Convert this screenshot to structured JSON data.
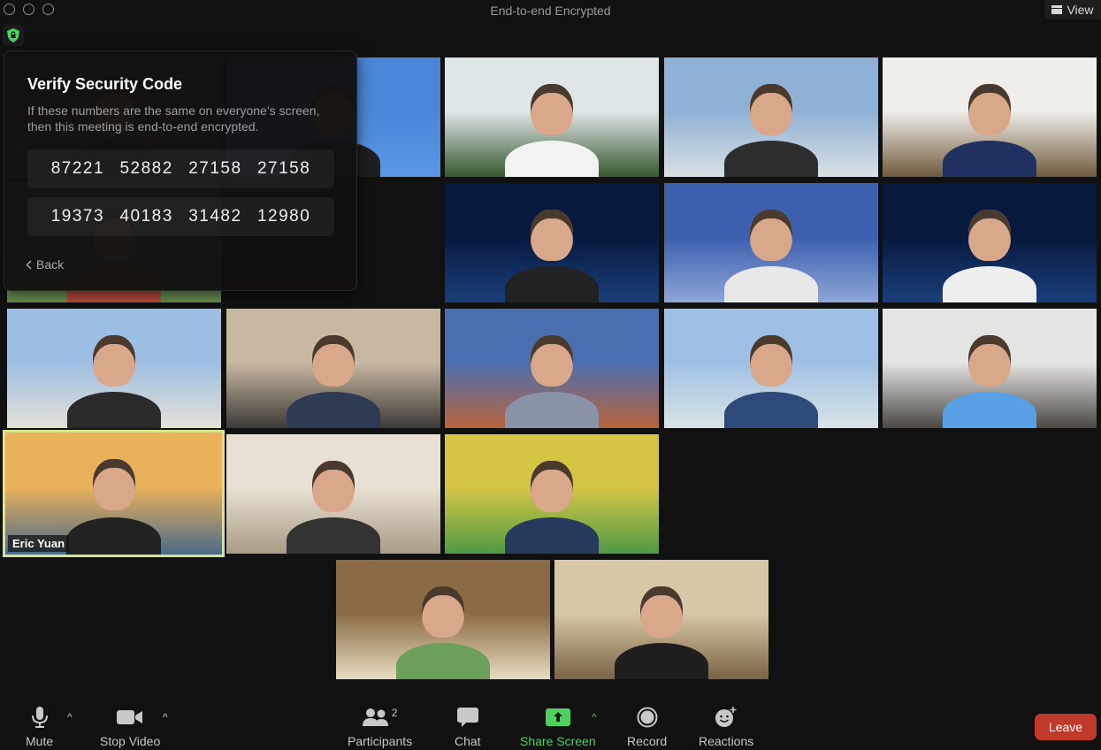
{
  "window": {
    "title": "End-to-end Encrypted",
    "view_label": "View"
  },
  "security_popup": {
    "title": "Verify Security Code",
    "description": "If these numbers are the same on everyone’s screen, then this meeting is end-to-end encrypted.",
    "code_rows": [
      [
        "87221",
        "52882",
        "27158",
        "27158"
      ],
      [
        "19373",
        "40183",
        "31482",
        "12980"
      ]
    ],
    "back_label": "Back"
  },
  "participants": {
    "active_speaker_name": "Eric Yuan",
    "tiles": [
      {
        "bg": "zoom-logo-wall-dark",
        "colors": [
          "#3d4150",
          "#5a5f72"
        ]
      },
      {
        "bg": "zoom-logo-wall-blue",
        "colors": [
          "#4a86d8",
          "#5b97e6"
        ]
      },
      {
        "bg": "city-plants",
        "colors": [
          "#dfe6e8",
          "#36582c"
        ]
      },
      {
        "bg": "beach",
        "colors": [
          "#8fb1d6",
          "#d9e0e3"
        ]
      },
      {
        "bg": "office-tv",
        "colors": [
          "#f0eeea",
          "#6f5b3c"
        ]
      },
      {
        "bg": "lagoon",
        "colors": [
          "#3f9c8c",
          "#6b8b4a"
        ]
      },
      {
        "bg": "beach",
        "colors": [
          "#a9c4e4",
          "#e2e4e2"
        ]
      },
      {
        "bg": "space-earth",
        "colors": [
          "#071a3e",
          "#1b3f7c"
        ]
      },
      {
        "bg": "blue-room",
        "colors": [
          "#3c5fae",
          "#8ea6d8"
        ]
      },
      {
        "bg": "space-earth",
        "colors": [
          "#071a3e",
          "#1b3f7c"
        ]
      },
      {
        "bg": "beach",
        "colors": [
          "#9dbfe3",
          "#e5e1d6"
        ]
      },
      {
        "bg": "home-office",
        "colors": [
          "#c7b8a2",
          "#3d3a36"
        ]
      },
      {
        "bg": "sunset-mountain",
        "colors": [
          "#4a6fb0",
          "#b8643c"
        ]
      },
      {
        "bg": "beach",
        "colors": [
          "#9fc0e4",
          "#d9e4e6"
        ]
      },
      {
        "bg": "loft",
        "colors": [
          "#e4e4e2",
          "#4a4744"
        ]
      },
      {
        "bg": "golden-gate",
        "colors": [
          "#e9b15a",
          "#4a6a8a"
        ]
      },
      {
        "bg": "office",
        "colors": [
          "#e8e0d2",
          "#a89c86"
        ]
      },
      {
        "bg": "colorful-words",
        "colors": [
          "#d4c545",
          "#4f9a44"
        ]
      },
      {
        "bg": "bookshelf",
        "colors": [
          "#8a6b45",
          "#e7dcc0"
        ]
      },
      {
        "bg": "open-office",
        "colors": [
          "#d6c8a6",
          "#7a6244"
        ]
      }
    ]
  },
  "toolbar": {
    "mute": "Mute",
    "stop_video": "Stop Video",
    "participants": "Participants",
    "participant_count": "2",
    "chat": "Chat",
    "share_screen": "Share Screen",
    "record": "Record",
    "reactions": "Reactions",
    "leave": "Leave",
    "accent_green": "#4fd15f",
    "leave_color": "#c0392b"
  }
}
